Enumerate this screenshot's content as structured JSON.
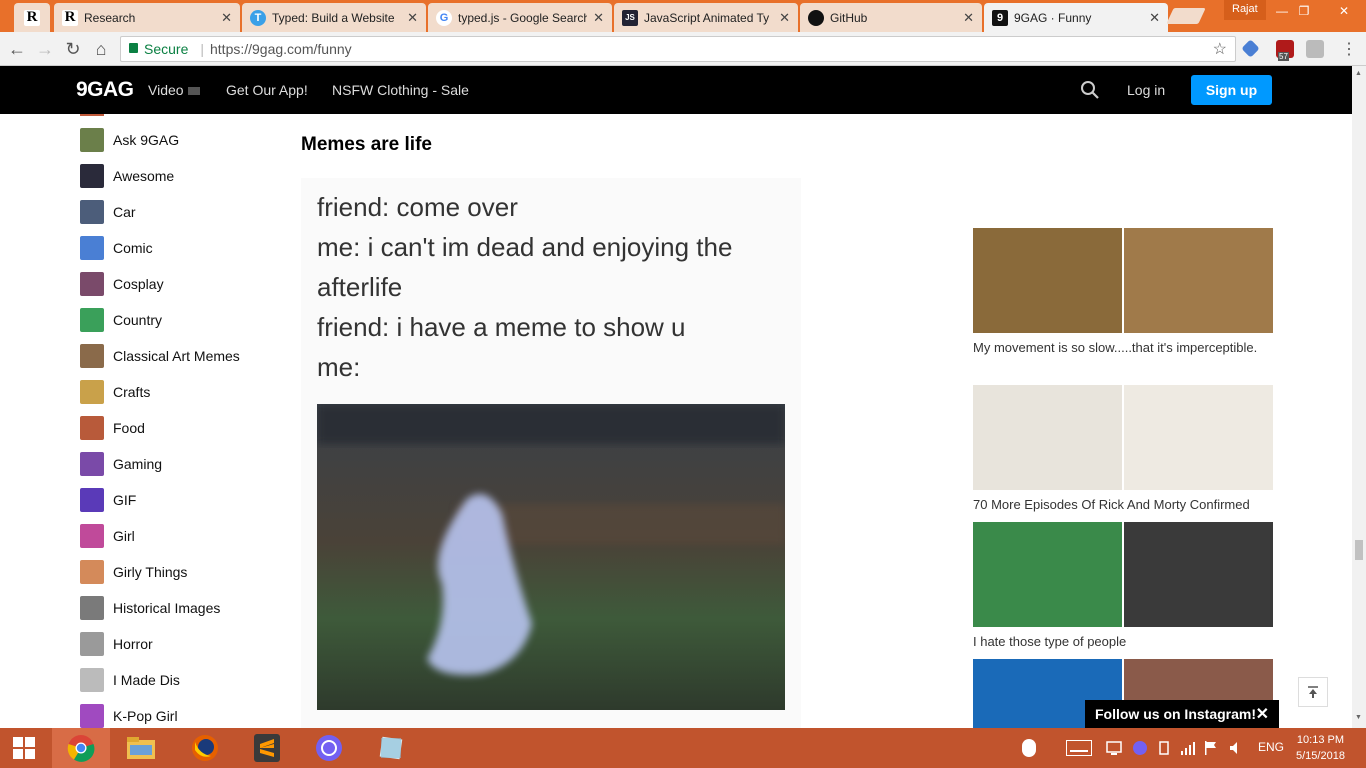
{
  "browser": {
    "tabs": [
      {
        "title": "",
        "icon": "R"
      },
      {
        "title": "Research",
        "icon": "R"
      },
      {
        "title": "Typed: Build a Website",
        "icon": "T"
      },
      {
        "title": "typed.js - Google Search",
        "icon": "G"
      },
      {
        "title": "JavaScript Animated Ty",
        "icon": "JS"
      },
      {
        "title": "GitHub",
        "icon": "github-icon"
      },
      {
        "title": "9GAG · Funny",
        "icon": "9"
      }
    ],
    "profile_name": "Rajat",
    "secure_label": "Secure",
    "url": "https://9gag.com/funny",
    "extension_badge": "57"
  },
  "site": {
    "logo": "9GAG",
    "nav": [
      "Video",
      "Get Our App!",
      "NSFW Clothing - Sale"
    ],
    "login_label": "Log in",
    "signup_label": "Sign up"
  },
  "sidebar": {
    "categories": [
      {
        "label": "Ask 9GAG",
        "color": "#6b7f4a"
      },
      {
        "label": "Awesome",
        "color": "#2a2a3a"
      },
      {
        "label": "Car",
        "color": "#4c5d7a"
      },
      {
        "label": "Comic",
        "color": "#4a7fd4"
      },
      {
        "label": "Cosplay",
        "color": "#7a4a6a"
      },
      {
        "label": "Country",
        "color": "#3aa05a"
      },
      {
        "label": "Classical Art Memes",
        "color": "#8a6a4a"
      },
      {
        "label": "Crafts",
        "color": "#c9a14a"
      },
      {
        "label": "Food",
        "color": "#b85a3a"
      },
      {
        "label": "Gaming",
        "color": "#7a4aa8"
      },
      {
        "label": "GIF",
        "color": "#5a3ab8"
      },
      {
        "label": "Girl",
        "color": "#c04a9a"
      },
      {
        "label": "Girly Things",
        "color": "#d48a5a"
      },
      {
        "label": "Historical Images",
        "color": "#7a7a7a"
      },
      {
        "label": "Horror",
        "color": "#9a9a9a"
      },
      {
        "label": "I Made Dis",
        "color": "#bbbbbb"
      },
      {
        "label": "K-Pop Girl",
        "color": "#a04ac0"
      }
    ]
  },
  "post": {
    "title": "Memes are life",
    "lines": [
      "friend: come over",
      "me: i can't im dead and enjoying the",
      "afterlife",
      "friend: i have a meme to show u",
      "me:"
    ]
  },
  "rail": [
    {
      "caption": "My movement is so slow.....that it's imperceptible.",
      "colors": [
        "#8a6a3a",
        "#a07a4a"
      ]
    },
    {
      "caption": "70 More Episodes Of Rick And Morty Confirmed",
      "colors": [
        "#e8e4dc",
        "#eeeae2"
      ]
    },
    {
      "caption": "I hate those type of people",
      "colors": [
        "#3a8a4a",
        "#3a3a3a"
      ]
    },
    {
      "caption": "",
      "colors": [
        "#1a6ab8",
        "#8a5a4a"
      ]
    }
  ],
  "follow_banner": "Follow us on Instagram!",
  "taskbar": {
    "language": "ENG",
    "time": "10:13 PM",
    "date": "5/15/2018"
  }
}
